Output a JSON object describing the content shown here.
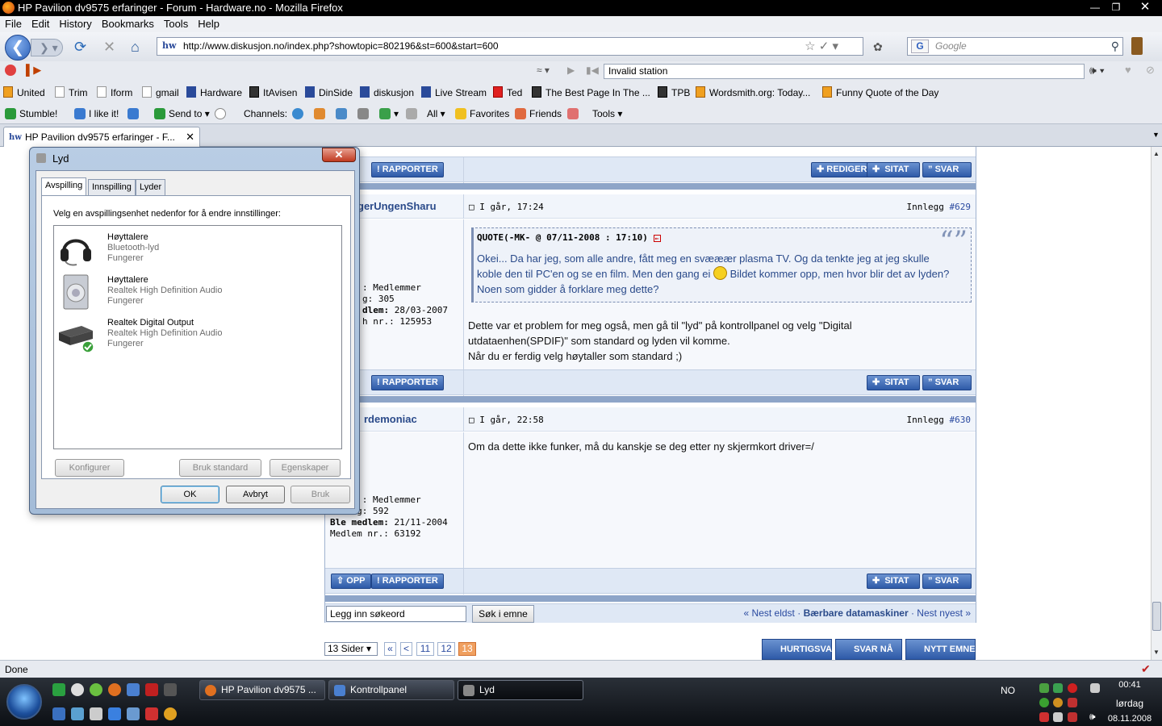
{
  "window": {
    "title": "HP Pavilion dv9575 erfaringer - Forum - Hardware.no - Mozilla Firefox"
  },
  "menu": [
    "File",
    "Edit",
    "History",
    "Bookmarks",
    "Tools",
    "Help"
  ],
  "nav": {
    "url": "http://www.diskusjon.no/index.php?showtopic=802196&st=600&start=600",
    "search_placeholder": "Google",
    "site_badge": "hw"
  },
  "radio": {
    "station": "Invalid station"
  },
  "bookmarks": [
    "United",
    "Trim",
    "Iform",
    "gmail",
    "Hardware",
    "ItAvisen",
    "DinSide",
    "diskusjon",
    "Live Stream",
    "Ted",
    "The Best Page In The ...",
    "TPB",
    "Wordsmith.org: Today...",
    "Funny Quote of the Day"
  ],
  "stumble": {
    "stumble": "Stumble!",
    "like": "I like it!",
    "send": "Send to",
    "channels": "Channels:",
    "all": "All",
    "favorites": "Favorites",
    "friends": "Friends",
    "tools": "Tools"
  },
  "tab": {
    "label": "HP Pavilion dv9575 erfaringer - F..."
  },
  "forum": {
    "rapporter": "RAPPORTER",
    "redigér": "REDIGER",
    "sitat": "SITAT",
    "svar": "SVAR",
    "opp": "OPP",
    "post629": {
      "user": "gerUngenSharu",
      "date": "I går, 17:24",
      "innlegg": "Innlegg",
      "num": "#629",
      "stats": [
        "Medlemmer",
        "305",
        "28/03-2007",
        "125953"
      ],
      "stat_labels": [
        "dlem:",
        "nr.:"
      ],
      "quote_header": "QUOTE(-MK- @ 07/11-2008 : 17:10)",
      "quote_text_a": "Okei... Da har jeg, som alle andre, fått meg en svææær plasma TV. Og da tenkte jeg at jeg skulle koble den til PC'en og se en film. Men den gang ei",
      "quote_text_b": " Bildet kommer opp, men hvor blir det av lyden? Noen som gidder å forklare meg dette?",
      "body_1": "Dette var et problem for meg også, men gå til \"lyd\" på kontrollpanel og velg \"Digital utdataenhen(SPDIF)\" som standard og lyden vil komme.",
      "body_2": "Når du er ferdig velg høytaller som standard ;)"
    },
    "post630": {
      "user": "rdemoniac",
      "date": "I går, 22:58",
      "innlegg": "Innlegg",
      "num": "#630",
      "stats": [
        "Medlemmer",
        "592",
        "21/11-2004",
        "63192"
      ],
      "stat_labels": [
        "Ble medlem:",
        "Medlem nr.:"
      ],
      "body": "Om da dette ikke funker, må du kanskje se deg etter ny skjermkort driver=/"
    },
    "search_placeholder": "Legg inn søkeord",
    "search_button": "Søk i emne",
    "nav_prev": "« Nest eldst",
    "nav_section": "Bærbare datamaskiner",
    "nav_next": "Nest nyest »",
    "pages_select": "13 Sider",
    "pages": [
      "«",
      "<",
      "11",
      "12",
      "13"
    ],
    "hurtigsvar": "HURTIGSVAR",
    "svar_naa": "SVAR NÅ",
    "nytt_emne": "NYTT EMNE"
  },
  "status": {
    "text": "Done"
  },
  "dialog": {
    "title": "Lyd",
    "tabs": [
      "Avspilling",
      "Innspilling",
      "Lyder"
    ],
    "instruction": "Velg en avspillingsenhet nedenfor for å endre innstillinger:",
    "devices": [
      {
        "name": "Høyttalere",
        "sub": "Bluetooth-lyd",
        "status": "Fungerer"
      },
      {
        "name": "Høyttalere",
        "sub": "Realtek High Definition Audio",
        "status": "Fungerer"
      },
      {
        "name": "Realtek Digital Output",
        "sub": "Realtek High Definition Audio",
        "status": "Fungerer"
      }
    ],
    "btn_configure": "Konfigurer",
    "btn_default": "Bruk standard",
    "btn_properties": "Egenskaper",
    "btn_ok": "OK",
    "btn_cancel": "Avbryt",
    "btn_apply": "Bruk"
  },
  "taskbar": {
    "items": [
      "HP Pavilion dv9575 ...",
      "Kontrollpanel",
      "Lyd"
    ],
    "lang": "NO",
    "time": "00:41",
    "day": "lørdag",
    "date": "08.11.2008"
  }
}
